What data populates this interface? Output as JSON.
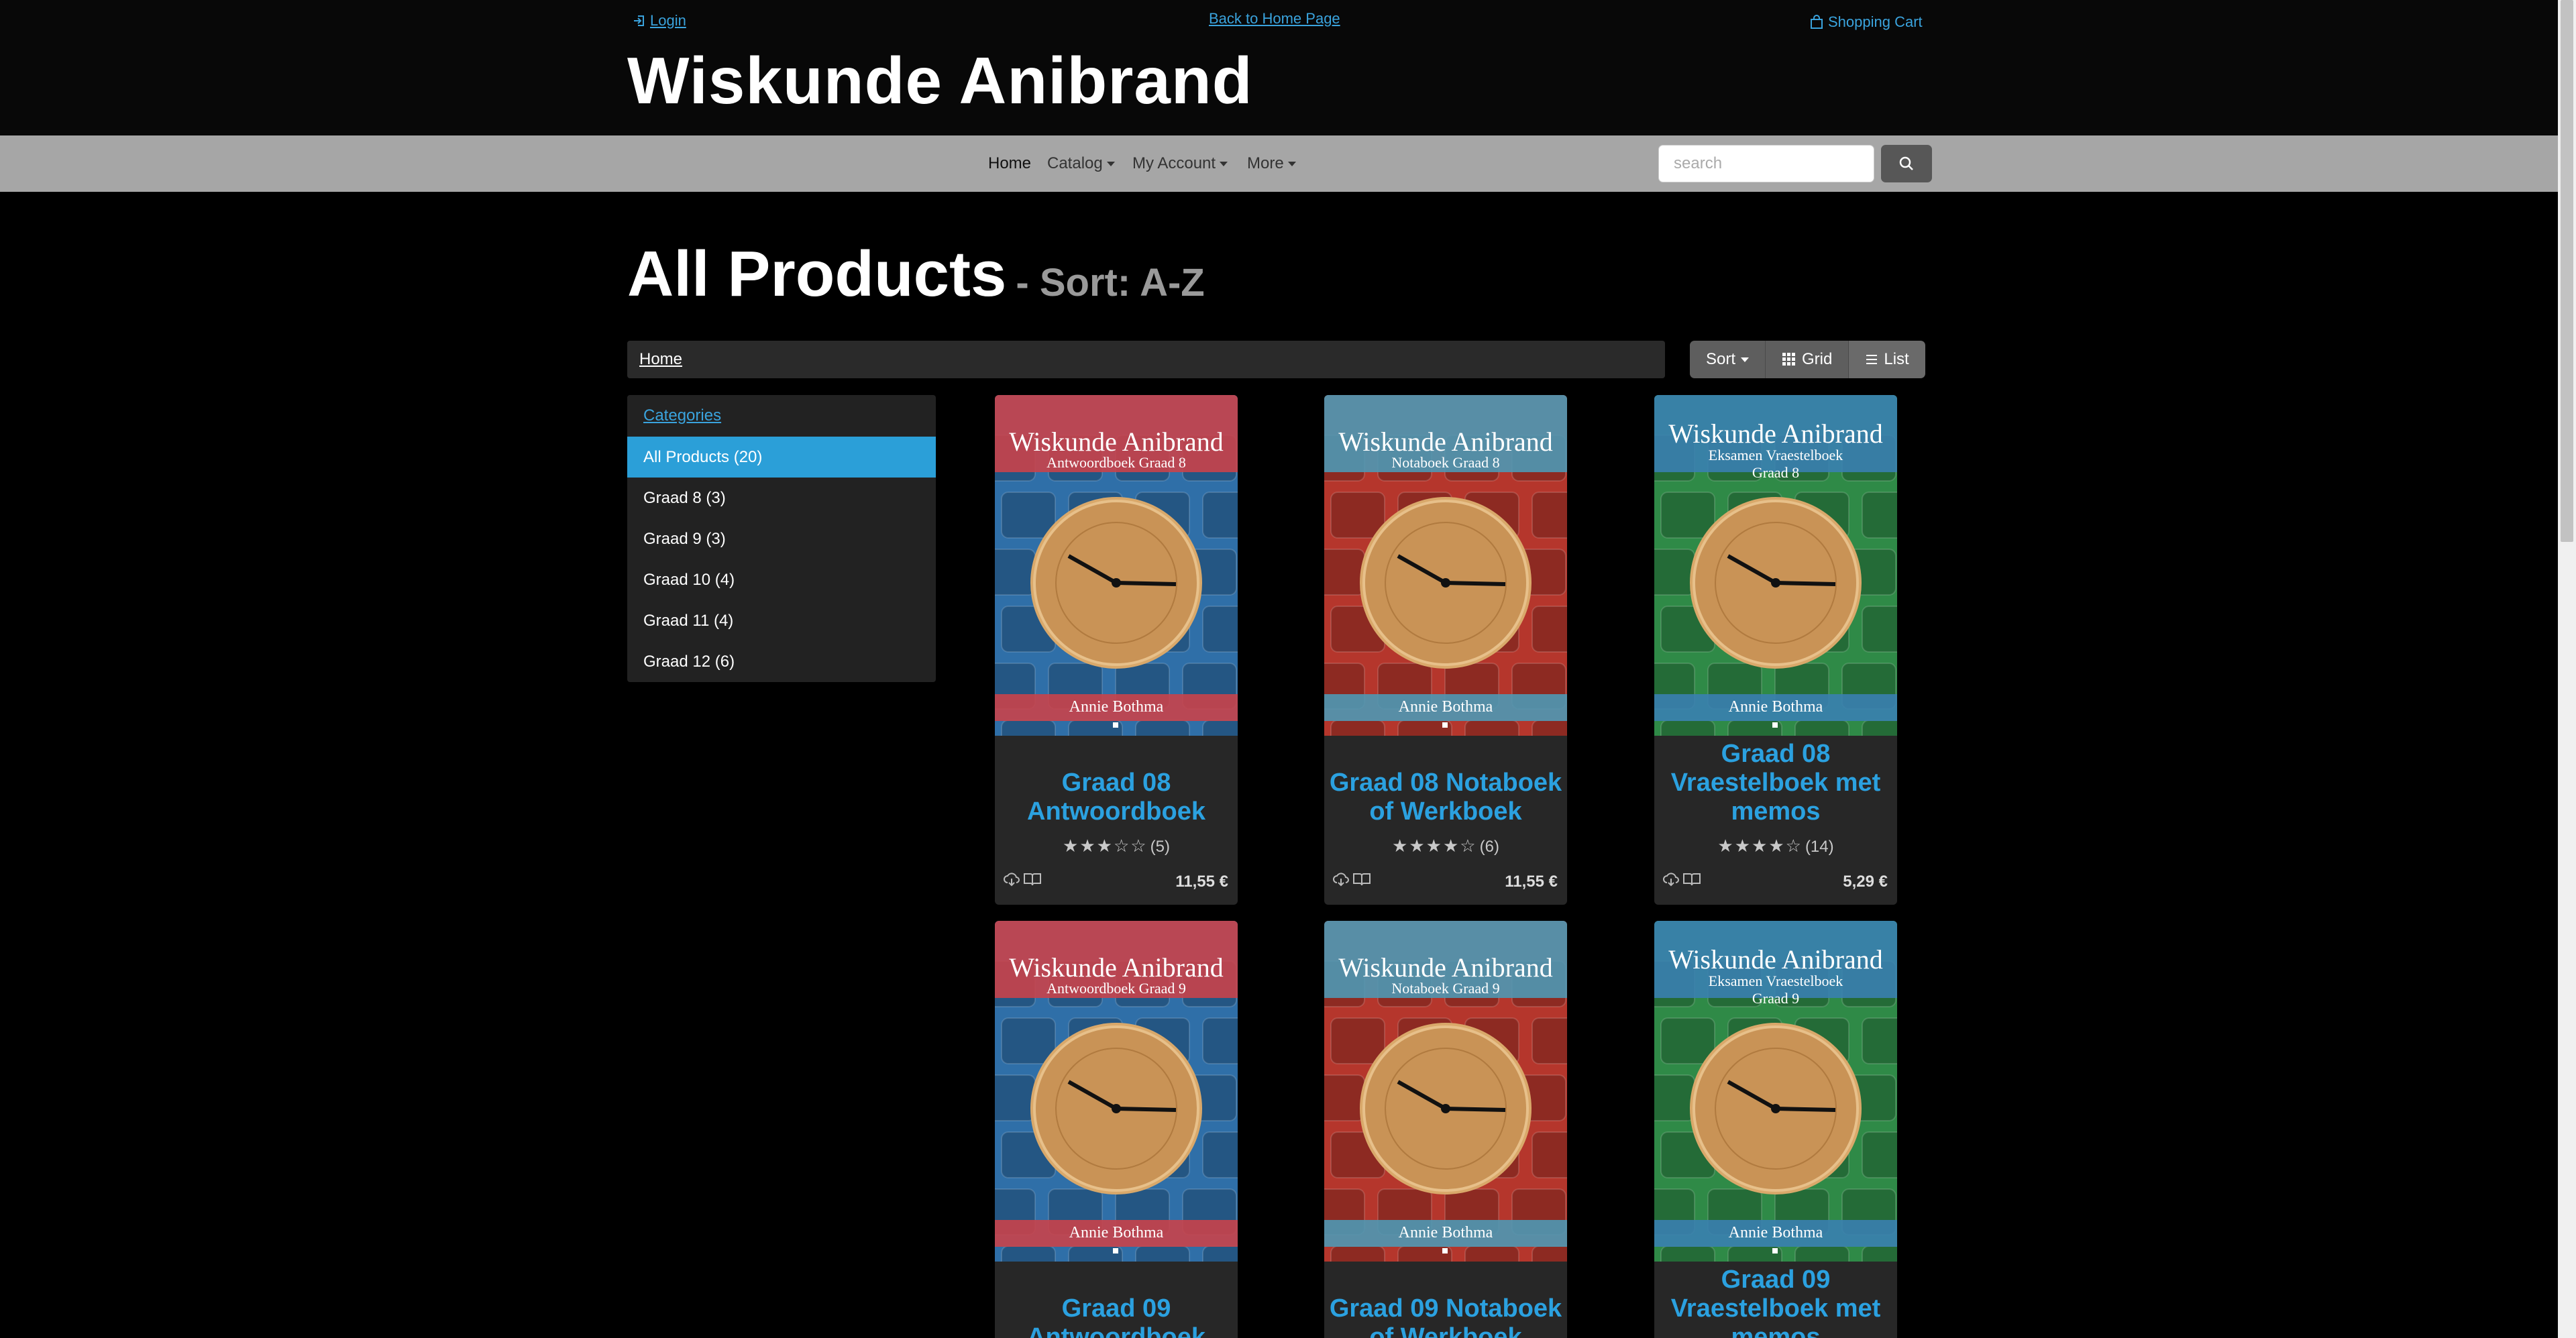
{
  "header": {
    "login_label": "Login",
    "home_link": "Back to Home Page",
    "cart_label": "Shopping Cart",
    "site_title": "Wiskunde Anibrand"
  },
  "nav": {
    "home": "Home",
    "catalog": "Catalog",
    "account": "My Account",
    "more": "More",
    "search_placeholder": "search"
  },
  "page": {
    "title": "All Products",
    "sort_subtitle": "- Sort: A-Z",
    "breadcrumb": "Home"
  },
  "toolbar": {
    "sort": "Sort",
    "grid": "Grid",
    "list": "List"
  },
  "sidebar": {
    "heading": "Categories",
    "items": [
      {
        "label": "All Products (20)"
      },
      {
        "label": "Graad 8 (3)"
      },
      {
        "label": "Graad 9 (3)"
      },
      {
        "label": "Graad 10 (4)"
      },
      {
        "label": "Graad 11 (4)"
      },
      {
        "label": "Graad 12 (6)"
      }
    ]
  },
  "products": [
    {
      "title_line1": "Graad 08",
      "title_line2": "Antwoordboek",
      "title_line3": "",
      "cover_title": "Wiskunde Anibrand",
      "cover_sub1": "Antwoordboek Graad 8",
      "cover_sub2": "",
      "cover_author": "Annie Bothma",
      "stars": 3,
      "rating_count": "(5)",
      "price": "11,55 €",
      "theme": "blue"
    },
    {
      "title_line1": "Graad 08 Notaboek",
      "title_line2": "of Werkboek",
      "title_line3": "",
      "cover_title": "Wiskunde Anibrand",
      "cover_sub1": "Notaboek Graad 8",
      "cover_sub2": "",
      "cover_author": "Annie Bothma",
      "stars": 4,
      "rating_count": "(6)",
      "price": "11,55 €",
      "theme": "red"
    },
    {
      "title_line1": "Graad 08",
      "title_line2": "Vraestelboek met",
      "title_line3": "memos",
      "cover_title": "Wiskunde Anibrand",
      "cover_sub1": "Eksamen Vraestelboek",
      "cover_sub2": "Graad 8",
      "cover_author": "Annie Bothma",
      "stars": 4,
      "rating_count": "(14)",
      "price": "5,29 €",
      "theme": "green"
    },
    {
      "title_line1": "Graad 09",
      "title_line2": "Antwoordboek",
      "title_line3": "",
      "cover_title": "Wiskunde Anibrand",
      "cover_sub1": "Antwoordboek Graad 9",
      "cover_sub2": "",
      "cover_author": "Annie Bothma",
      "theme": "blue"
    },
    {
      "title_line1": "Graad 09 Notaboek",
      "title_line2": "of Werkboek",
      "title_line3": "",
      "cover_title": "Wiskunde Anibrand",
      "cover_sub1": "Notaboek Graad 9",
      "cover_sub2": "",
      "cover_author": "Annie Bothma",
      "theme": "red"
    },
    {
      "title_line1": "Graad 09",
      "title_line2": "Vraestelboek met",
      "title_line3": "memos",
      "cover_title": "Wiskunde Anibrand",
      "cover_sub1": "Eksamen Vraestelboek",
      "cover_sub2": "Graad 9",
      "cover_author": "Annie Bothma",
      "theme": "green"
    }
  ],
  "colors": {
    "accent": "#2ba1e0",
    "sidebar_active": "#2b9fd8",
    "navbar": "#a6a6a6",
    "blue_cover": "#2f6fa8",
    "red_cover": "#b5362c",
    "green_cover": "#2f8a47"
  }
}
